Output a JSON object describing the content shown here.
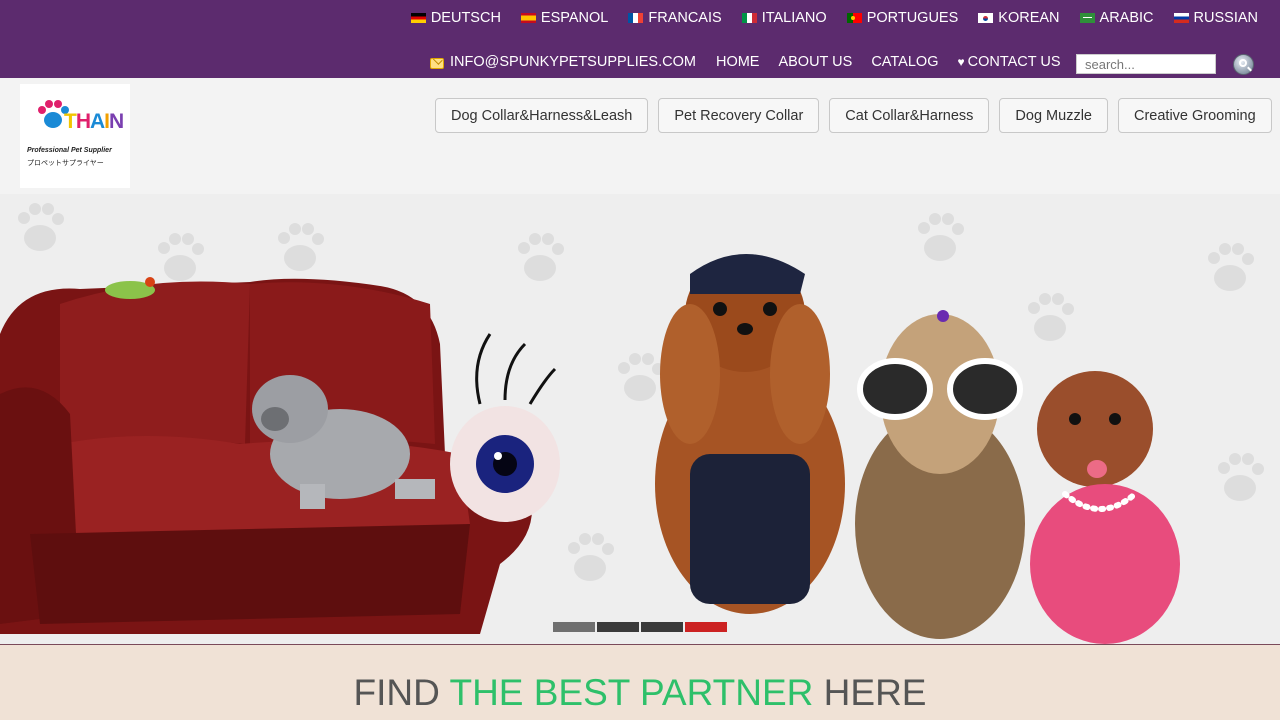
{
  "languages": [
    {
      "label": "DEUTSCH",
      "flag": "de"
    },
    {
      "label": "ESPANOL",
      "flag": "es"
    },
    {
      "label": "FRANCAIS",
      "flag": "fr"
    },
    {
      "label": "ITALIANO",
      "flag": "it"
    },
    {
      "label": "PORTUGUES",
      "flag": "pt"
    },
    {
      "label": "KOREAN",
      "flag": "kr"
    },
    {
      "label": "ARABIC",
      "flag": "ar"
    },
    {
      "label": "RUSSIAN",
      "flag": "ru"
    }
  ],
  "nav": {
    "email": "INFO@SPUNKYPETSUPPLIES.COM",
    "home": "HOME",
    "about": "ABOUT US",
    "catalog": "CATALOG",
    "contact": "CONTACT US"
  },
  "search": {
    "placeholder": "search...",
    "value": ""
  },
  "logo": {
    "letters": "THAIN",
    "tagline": "Professional Pet Supplier",
    "subtitle_jp": "プロペットサプライヤー"
  },
  "categories": [
    "Dog Collar&Harness&Leash",
    "Pet Recovery Collar",
    "Cat Collar&Harness",
    "Dog Muzzle",
    "Creative Grooming"
  ],
  "slider": {
    "count": 4,
    "active_index": 3
  },
  "banner": {
    "part1": "FIND ",
    "highlight": "THE BEST PARTNER",
    "part2": " HERE"
  },
  "colors": {
    "topbar": "#5c2b6e",
    "header_bg": "#f3f3f3",
    "banner_bg": "#f0e2d6",
    "banner_highlight": "#2ec06a",
    "slider_active": "#cc2222"
  }
}
